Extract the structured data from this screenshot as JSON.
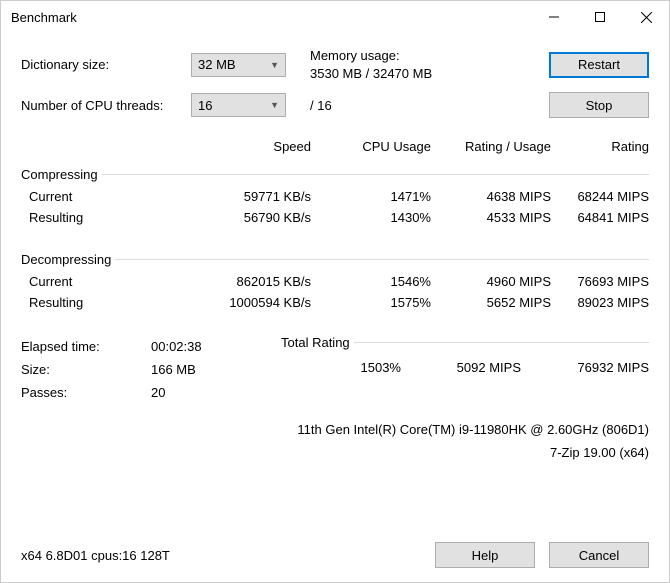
{
  "window": {
    "title": "Benchmark"
  },
  "controls": {
    "dict_label": "Dictionary size:",
    "dict_value": "32 MB",
    "mem_label": "Memory usage:",
    "mem_value": "3530 MB / 32470 MB",
    "threads_label": "Number of CPU threads:",
    "threads_value": "16",
    "threads_suffix": "/ 16",
    "restart": "Restart",
    "stop": "Stop"
  },
  "headers": {
    "speed": "Speed",
    "cpu_usage": "CPU Usage",
    "rating_usage": "Rating / Usage",
    "rating": "Rating"
  },
  "compressing": {
    "title": "Compressing",
    "current_label": "Current",
    "resulting_label": "Resulting",
    "current": {
      "speed": "59771 KB/s",
      "cpu": "1471%",
      "rup": "4638 MIPS",
      "rating": "68244 MIPS"
    },
    "resulting": {
      "speed": "56790 KB/s",
      "cpu": "1430%",
      "rup": "4533 MIPS",
      "rating": "64841 MIPS"
    }
  },
  "decompressing": {
    "title": "Decompressing",
    "current_label": "Current",
    "resulting_label": "Resulting",
    "current": {
      "speed": "862015 KB/s",
      "cpu": "1546%",
      "rup": "4960 MIPS",
      "rating": "76693 MIPS"
    },
    "resulting": {
      "speed": "1000594 KB/s",
      "cpu": "1575%",
      "rup": "5652 MIPS",
      "rating": "89023 MIPS"
    }
  },
  "summary": {
    "elapsed_label": "Elapsed time:",
    "elapsed_value": "00:02:38",
    "size_label": "Size:",
    "size_value": "166 MB",
    "passes_label": "Passes:",
    "passes_value": "20"
  },
  "total": {
    "title": "Total Rating",
    "cpu": "1503%",
    "rup": "5092 MIPS",
    "rating": "76932 MIPS"
  },
  "cpu_info": "11th Gen Intel(R) Core(TM) i9-11980HK @ 2.60GHz (806D1)",
  "app_version": "7-Zip 19.00 (x64)",
  "footer": {
    "build": "x64 6.8D01 cpus:16 128T",
    "help": "Help",
    "cancel": "Cancel"
  }
}
